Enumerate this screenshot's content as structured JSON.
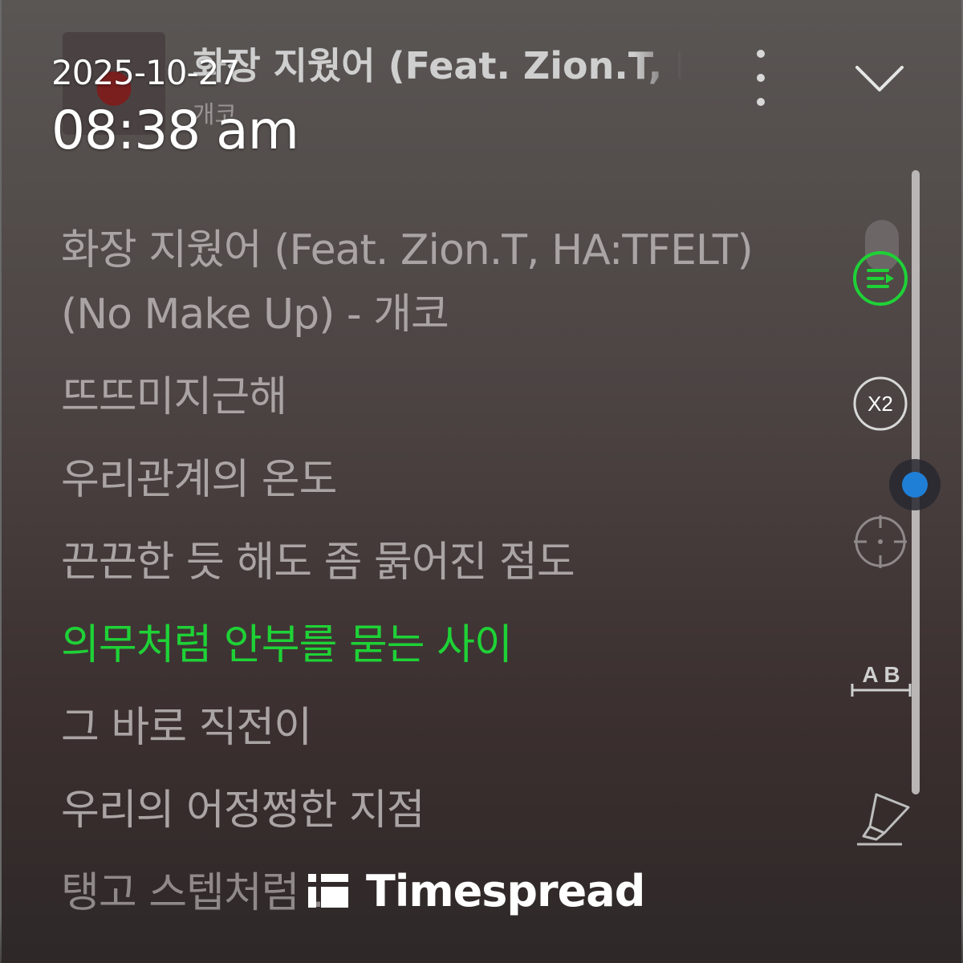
{
  "header": {
    "song_title": "화장 지웠어 (Feat. Zion.T, HA:TFELT)",
    "artist": "개코"
  },
  "timestamp": {
    "date": "2025-10-27",
    "time": "08:38 am"
  },
  "lyrics": {
    "lines": [
      "화장 지웠어 (Feat. Zion.T, HA:TFELT) (No Make Up) - 개코",
      "뜨뜨미지근해",
      "우리관계의 온도",
      "끈끈한 듯 해도 좀 묽어진 점도",
      "의무처럼 안부를 묻는 사이",
      "그 바로 직전이",
      "우리의 어정쩡한 지점",
      "탱고 스텝처럼 ..."
    ],
    "active_index": 4
  },
  "controls": {
    "speed_label": "X2",
    "ab_label": "A B",
    "icons": [
      "playlist-play-icon",
      "speed-x2-icon",
      "crosshair-icon",
      "ab-repeat-icon",
      "highlighter-icon",
      "chevron-down-icon",
      "more-vertical-icon"
    ]
  },
  "watermark": {
    "brand": "Timespread"
  },
  "colors": {
    "active_lyric": "#1ed236",
    "inactive_lyric": "#aaa5a4",
    "scroll_thumb": "#1f7fd6"
  }
}
